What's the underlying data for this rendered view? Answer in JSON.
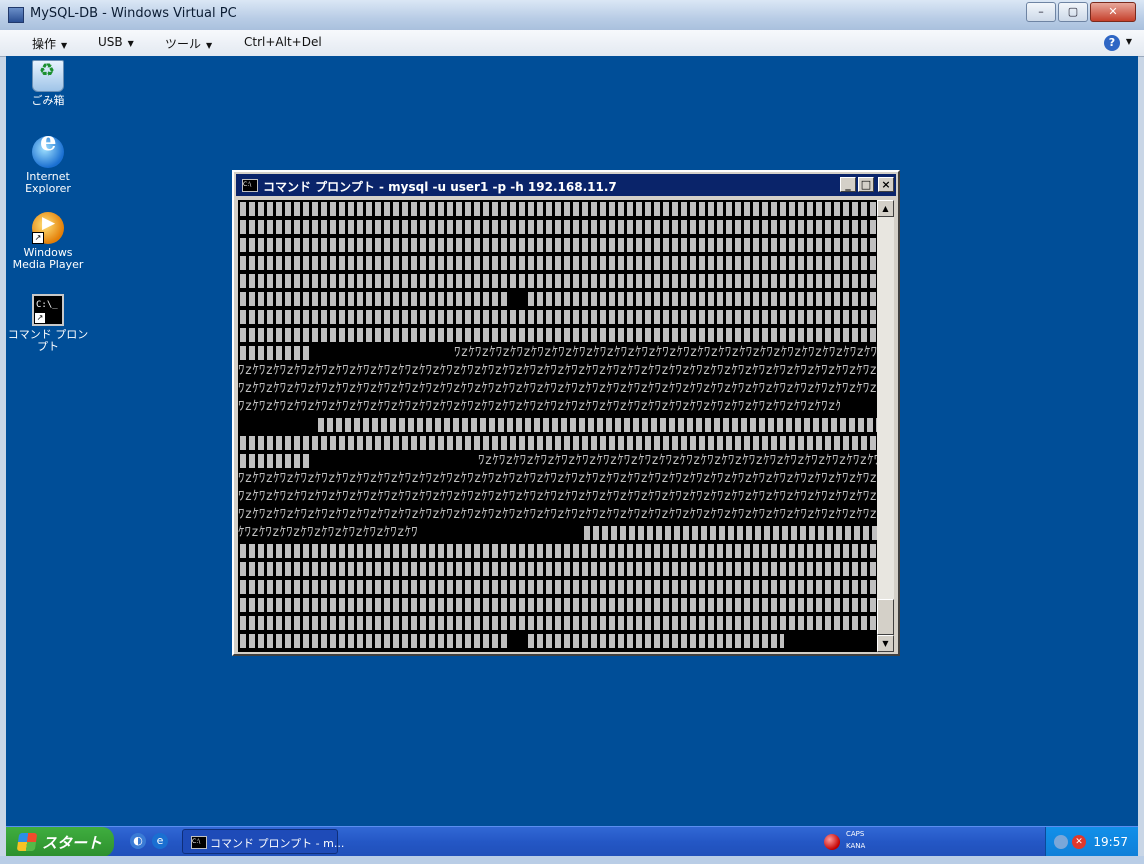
{
  "window": {
    "title": "MySQL-DB - Windows Virtual PC"
  },
  "menu": {
    "items": [
      "操作",
      "USB",
      "ツール",
      "Ctrl+Alt+Del"
    ],
    "help": "?"
  },
  "desktop_icons": [
    "ごみ箱",
    "Internet Explorer",
    "Windows Media Player",
    "コマンド プロンプト"
  ],
  "console": {
    "title": "コマンド プロンプト - mysql -u user1 -p -h 192.168.11.7",
    "garbled_line": "ﾜzｹﾜzｹﾜzｹﾜzｹﾜzｹﾜzｹﾜzｹﾜzｹﾜzｹﾜzｹﾜzｹﾜzｹﾜzｹﾜzｹﾜzｹﾜzｹﾜzｹﾜzｹﾜzｹﾜzｹﾜzｹﾜzｹﾜzｹﾜzｹﾜzｹﾜzｹﾜzｹﾜzｹﾜzｹﾜzｹﾜzｹﾜzｹﾜzｹﾜzｹﾜzｹﾜzｹﾜzｹﾜzｹﾜzｹﾜzｹﾜzｹﾜzｹﾜz",
    "garbled_end1": "ﾜzｹﾜzｹﾜzｹﾜzｹﾜzｹﾜzｹﾜzｹﾜzｹﾜzｹﾜzｹﾜzｹﾜzｹﾜzｹﾜzｹﾜzｹﾜzｹﾜzｹﾜzｹﾜzｹﾜzｹﾜzｹﾜzｹﾜzｹﾜzｹﾜzｹﾜzｹﾜzｹﾜzｹﾜzｹﾜzｹﾜzｹﾜzｹﾜzｹ",
    "garbled_end2": "ｹﾜzｹﾜzｹﾜzｹﾜzｹﾜzｹﾜzｹﾜzｹﾜzｹﾜzｹ"
  },
  "taskbar": {
    "start_label": "スタート",
    "task_button": "コマンド プロンプト - m...",
    "ime_caps": "CAPS",
    "ime_kana": "KANA",
    "clock": "19:57"
  }
}
